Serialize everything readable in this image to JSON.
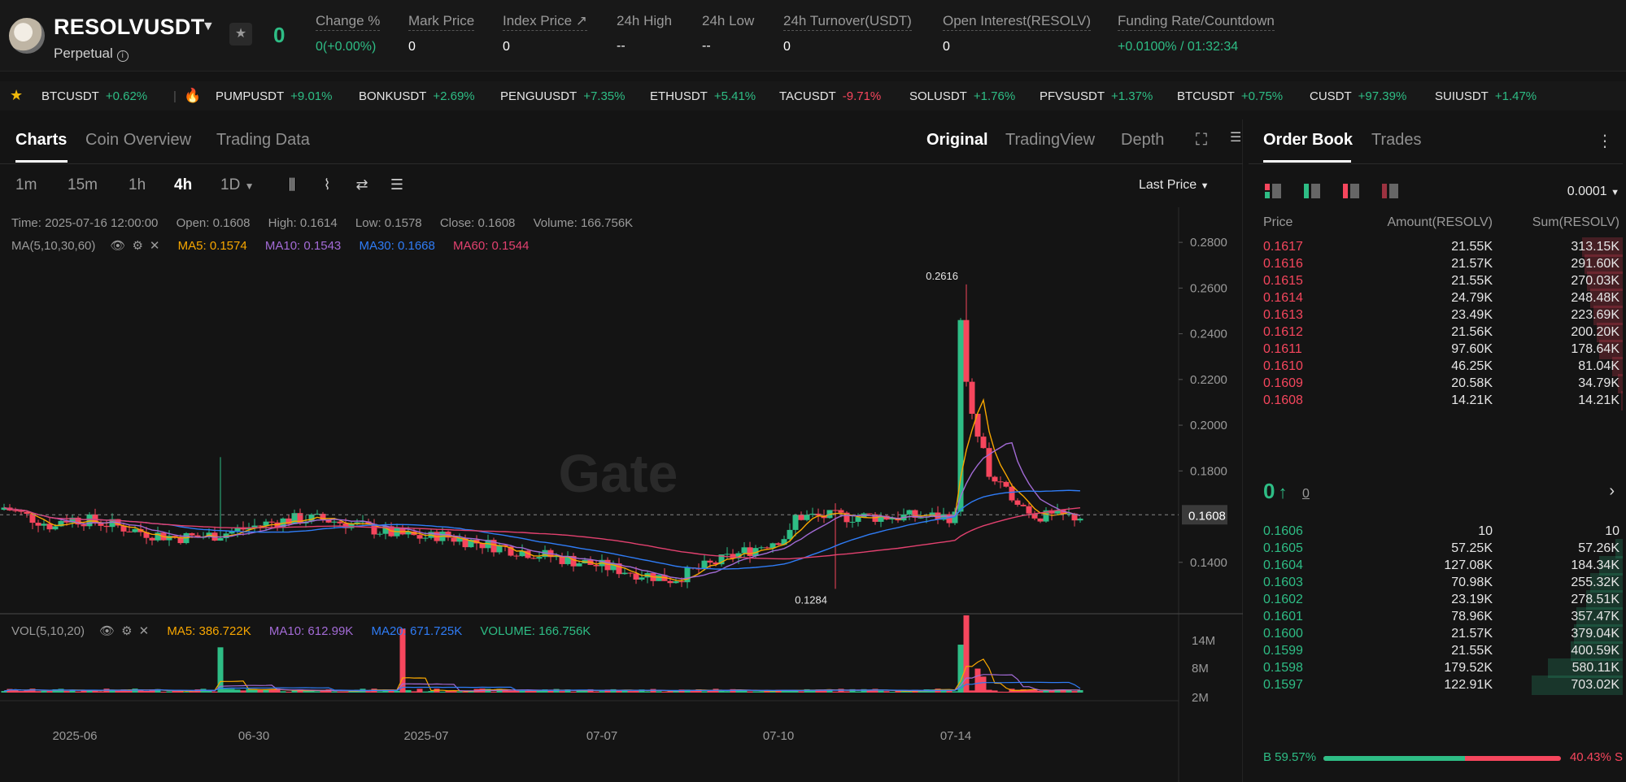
{
  "header": {
    "symbol": "RESOLVUSDT",
    "contract_type": "Perpetual",
    "last_price": "0",
    "stats": [
      {
        "label": "Change %",
        "value": "0(+0.00%)",
        "color": "green"
      },
      {
        "label": "Mark Price",
        "value": "0"
      },
      {
        "label": "Index Price",
        "value": "0"
      },
      {
        "label": "24h High",
        "value": "--"
      },
      {
        "label": "24h Low",
        "value": "--"
      },
      {
        "label": "24h Turnover(USDT)",
        "value": "0"
      },
      {
        "label": "Open Interest(RESOLV)",
        "value": "0"
      },
      {
        "label": "Funding Rate/Countdown",
        "value": "+0.0100% / 01:32:34",
        "color": "green"
      }
    ]
  },
  "market_strip": [
    {
      "symbol": "BTCUSDT",
      "change": "+0.62%",
      "dir": "up"
    },
    {
      "symbol": "PUMPUSDT",
      "change": "+9.01%",
      "dir": "up"
    },
    {
      "symbol": "BONKUSDT",
      "change": "+2.69%",
      "dir": "up"
    },
    {
      "symbol": "PENGUUSDT",
      "change": "+7.35%",
      "dir": "up"
    },
    {
      "symbol": "ETHUSDT",
      "change": "+5.41%",
      "dir": "up"
    },
    {
      "symbol": "TACUSDT",
      "change": "-9.71%",
      "dir": "down"
    },
    {
      "symbol": "SOLUSDT",
      "change": "+1.76%",
      "dir": "up"
    },
    {
      "symbol": "PFVSUSDT",
      "change": "+1.37%",
      "dir": "up"
    },
    {
      "symbol": "BTCUSDT",
      "change": "+0.75%",
      "dir": "up"
    },
    {
      "symbol": "CUSDT",
      "change": "+97.39%",
      "dir": "up"
    },
    {
      "symbol": "SUIUSDT",
      "change": "+1.47%",
      "dir": "up"
    }
  ],
  "chart_panel": {
    "tabs": [
      "Charts",
      "Coin Overview",
      "Trading Data"
    ],
    "view_tabs": [
      "Original",
      "TradingView",
      "Depth"
    ],
    "intervals": [
      "1m",
      "15m",
      "1h",
      "4h",
      "1D"
    ],
    "active_interval": "4h",
    "price_type": "Last Price",
    "ohlc": {
      "time": "Time: 2025-07-16 12:00:00",
      "open": "Open: 0.1608",
      "high": "High: 0.1614",
      "low": "Low: 0.1578",
      "close": "Close: 0.1608",
      "volume": "Volume: 166.756K"
    },
    "ma_legend": {
      "label": "MA(5,10,30,60)",
      "ma5": "MA5: 0.1574",
      "ma10": "MA10: 0.1543",
      "ma30": "MA30: 0.1668",
      "ma60": "MA60: 0.1544"
    },
    "vol_legend": {
      "label": "VOL(5,10,20)",
      "ma5": "MA5: 386.722K",
      "ma10": "MA10: 612.99K",
      "ma20": "MA20: 671.725K",
      "volume": "VOLUME: 166.756K"
    },
    "watermark": "Gate",
    "colors": {
      "up": "#2ebd85",
      "down": "#f6465d",
      "ma5": "#f7a600",
      "ma10": "#a36bd6",
      "ma30": "#2f7cf6",
      "ma60": "#e2416f"
    }
  },
  "chart_data": {
    "type": "candlestick",
    "price_axis_ticks": [
      "0.2800",
      "0.2600",
      "0.2400",
      "0.2200",
      "0.2000",
      "0.1800",
      "0.1400"
    ],
    "volume_axis_ticks": [
      "14M",
      "8M",
      "2M"
    ],
    "x_tick_labels": [
      "2025-06",
      "06-30",
      "2025-07",
      "07-07",
      "07-10",
      "07-14"
    ],
    "current_price_label": "0.1608",
    "high_marker": "0.2616",
    "low_marker": "0.1284",
    "ylim": [
      0.12,
      0.29
    ]
  },
  "order_book": {
    "tabs": [
      "Order Book",
      "Trades"
    ],
    "precision": "0.0001",
    "headers": {
      "price": "Price",
      "amount": "Amount(RESOLV)",
      "sum": "Sum(RESOLV)"
    },
    "asks": [
      {
        "price": "0.1617",
        "amount": "21.55K",
        "sum": "313.15K",
        "depth": 0.45
      },
      {
        "price": "0.1616",
        "amount": "21.57K",
        "sum": "291.60K",
        "depth": 0.42
      },
      {
        "price": "0.1615",
        "amount": "21.55K",
        "sum": "270.03K",
        "depth": 0.39
      },
      {
        "price": "0.1614",
        "amount": "24.79K",
        "sum": "248.48K",
        "depth": 0.36
      },
      {
        "price": "0.1613",
        "amount": "23.49K",
        "sum": "223.69K",
        "depth": 0.32
      },
      {
        "price": "0.1612",
        "amount": "21.56K",
        "sum": "200.20K",
        "depth": 0.29
      },
      {
        "price": "0.1611",
        "amount": "97.60K",
        "sum": "178.64K",
        "depth": 0.26
      },
      {
        "price": "0.1610",
        "amount": "46.25K",
        "sum": "81.04K",
        "depth": 0.12
      },
      {
        "price": "0.1609",
        "amount": "20.58K",
        "sum": "34.79K",
        "depth": 0.05
      },
      {
        "price": "0.1608",
        "amount": "14.21K",
        "sum": "14.21K",
        "depth": 0.02
      }
    ],
    "mid_price": "0",
    "mid_sub": "0",
    "bids": [
      {
        "price": "0.1606",
        "amount": "10",
        "sum": "10",
        "depth": 0.0
      },
      {
        "price": "0.1605",
        "amount": "57.25K",
        "sum": "57.26K",
        "depth": 0.08
      },
      {
        "price": "0.1604",
        "amount": "127.08K",
        "sum": "184.34K",
        "depth": 0.26
      },
      {
        "price": "0.1603",
        "amount": "70.98K",
        "sum": "255.32K",
        "depth": 0.36
      },
      {
        "price": "0.1602",
        "amount": "23.19K",
        "sum": "278.51K",
        "depth": 0.4
      },
      {
        "price": "0.1601",
        "amount": "78.96K",
        "sum": "357.47K",
        "depth": 0.51
      },
      {
        "price": "0.1600",
        "amount": "21.57K",
        "sum": "379.04K",
        "depth": 0.54
      },
      {
        "price": "0.1599",
        "amount": "21.55K",
        "sum": "400.59K",
        "depth": 0.57
      },
      {
        "price": "0.1598",
        "amount": "179.52K",
        "sum": "580.11K",
        "depth": 0.82
      },
      {
        "price": "0.1597",
        "amount": "122.91K",
        "sum": "703.02K",
        "depth": 1.0
      }
    ],
    "buy_ratio": "B 59.57%",
    "sell_ratio": "40.43% S",
    "buy_ratio_value": 59.57
  }
}
